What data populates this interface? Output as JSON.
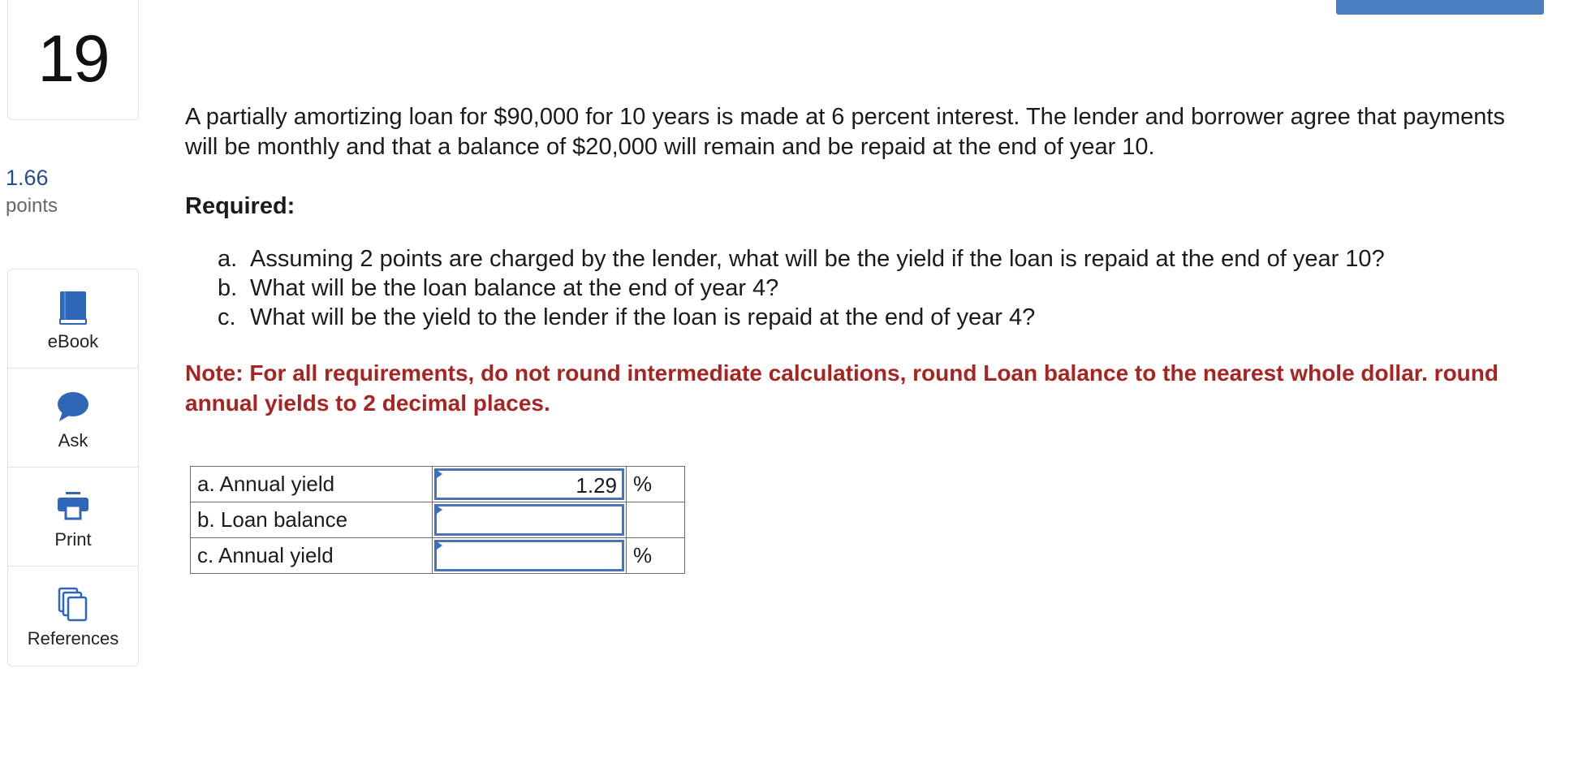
{
  "question": {
    "number": "19",
    "points_value": "1.66",
    "points_label": "points"
  },
  "tools": [
    {
      "label": "eBook",
      "icon": "book-icon"
    },
    {
      "label": "Ask",
      "icon": "chat-bubble-icon"
    },
    {
      "label": "Print",
      "icon": "printer-icon"
    },
    {
      "label": "References",
      "icon": "documents-icon"
    }
  ],
  "content": {
    "problem": "A partially amortizing loan for $90,000 for 10 years is made at 6 percent interest. The lender and borrower agree that payments will be monthly and that a balance of $20,000 will remain and be repaid at the end of year 10.",
    "required_label": "Required:",
    "requirements": [
      {
        "letter": "a.",
        "text": "Assuming 2 points are charged by the lender, what will be the yield if the loan is repaid at the end of year 10?"
      },
      {
        "letter": "b.",
        "text": "What will be the loan balance at the end of year 4?"
      },
      {
        "letter": "c.",
        "text": "What will be the yield to the lender if the loan is repaid at the end of year 4?"
      }
    ],
    "note": "Note: For all requirements, do not round intermediate calculations, round Loan balance to the nearest whole dollar. round annual yields to 2 decimal places."
  },
  "answers": [
    {
      "label": "a. Annual yield",
      "value": "1.29",
      "unit": "%"
    },
    {
      "label": "b. Loan balance",
      "value": "",
      "unit": ""
    },
    {
      "label": "c. Annual yield",
      "value": "",
      "unit": "%"
    }
  ],
  "colors": {
    "accent": "#4a7fc1",
    "note_red": "#a82423",
    "points_blue": "#244f8c"
  }
}
